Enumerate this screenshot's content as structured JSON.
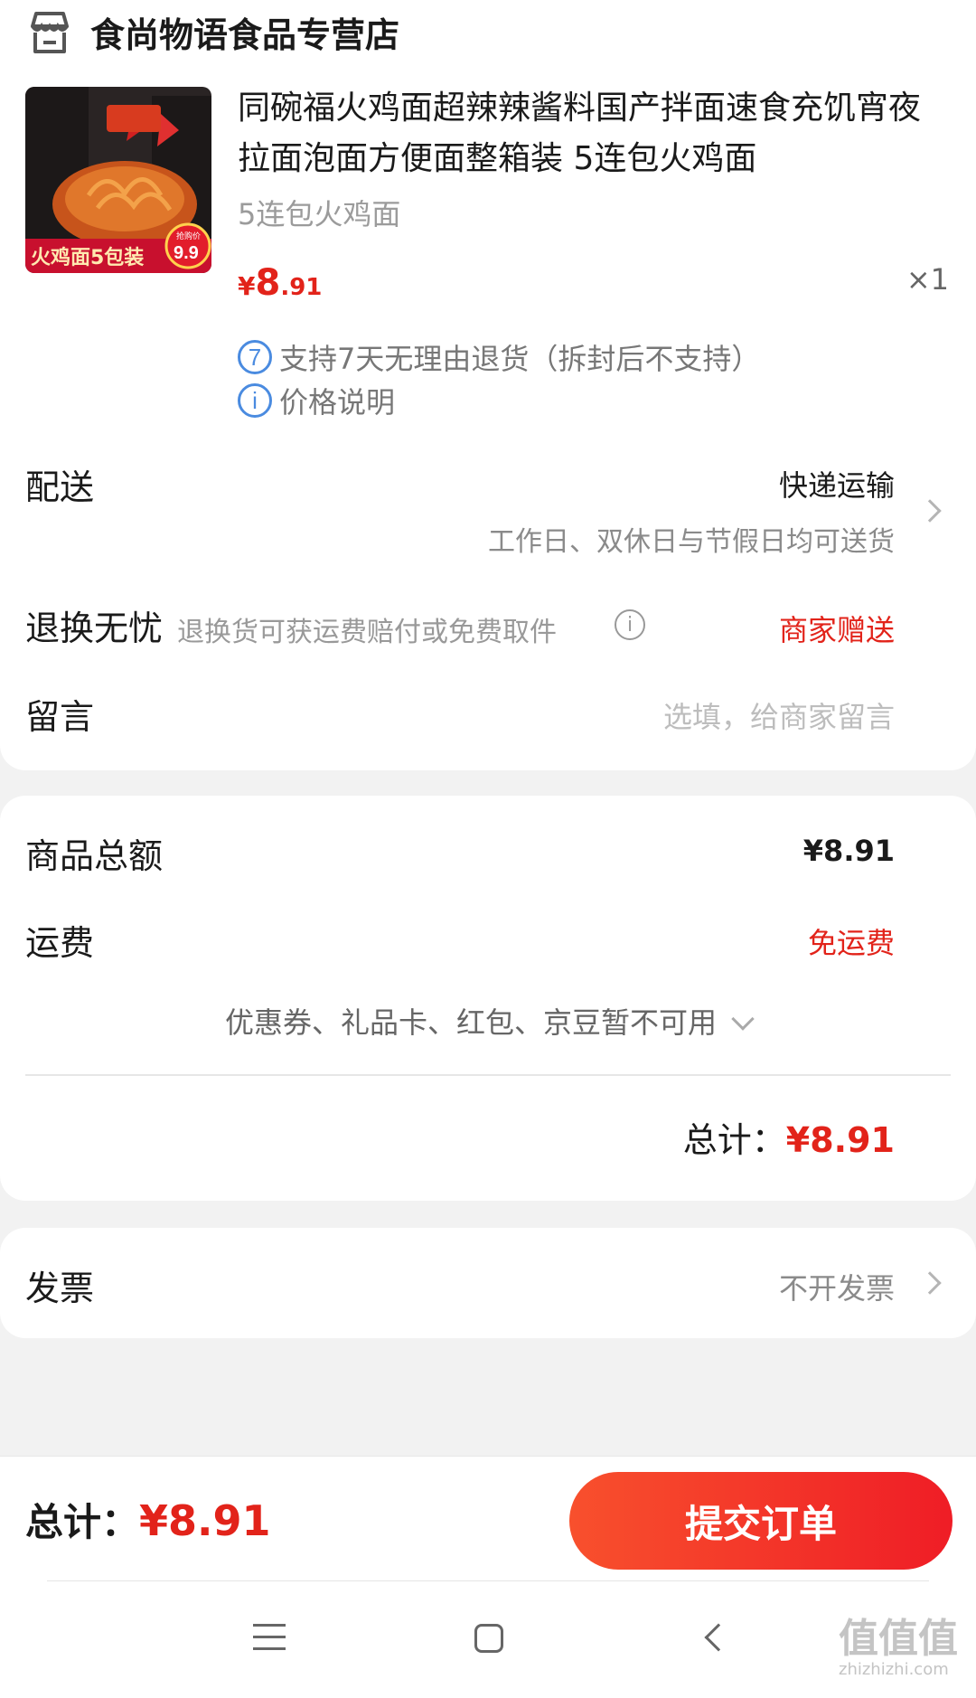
{
  "store": {
    "name": "食尚物语食品专营店",
    "icon": "store-icon"
  },
  "product": {
    "title": "同碗福火鸡面超辣辣酱料国产拌面速食充饥宵夜拉面泡面方便面整箱装 5连包火鸡面",
    "spec": "5连包火鸡面",
    "price_currency": "¥",
    "price_int": "8",
    "price_dec": ".91",
    "quantity": "×1",
    "image_banner": "火鸡面5包装",
    "image_price": "9.9",
    "image_price_label": "抢购价"
  },
  "services": [
    {
      "icon": "7",
      "text": "支持7天无理由退货（拆封后不支持）"
    },
    {
      "icon": "i",
      "text": "价格说明"
    }
  ],
  "delivery": {
    "label": "配送",
    "method": "快递运输",
    "note": "工作日、双休日与节假日均可送货"
  },
  "exchange": {
    "label": "退换无忧",
    "desc": "退换货可获运费赔付或免费取件",
    "value": "商家赠送"
  },
  "message": {
    "label": "留言",
    "placeholder": "选填，给商家留言"
  },
  "summary": {
    "goods_label": "商品总额",
    "goods_value": "¥8.91",
    "shipping_label": "运费",
    "shipping_value": "免运费",
    "coupon_text": "优惠券、礼品卡、红包、京豆暂不可用",
    "total_label": "总计：",
    "total_value": "¥8.91"
  },
  "invoice": {
    "label": "发票",
    "value": "不开发票"
  },
  "bottom": {
    "total_label": "总计：",
    "total_value": "¥8.91",
    "submit_label": "提交订单"
  },
  "watermark": {
    "main": "值值值",
    "sub": "zhizhizhi.com"
  },
  "colors": {
    "accent": "#e2231a",
    "button_start": "#f8502d",
    "button_end": "#ef1d26",
    "info_blue": "#4a8be0"
  }
}
